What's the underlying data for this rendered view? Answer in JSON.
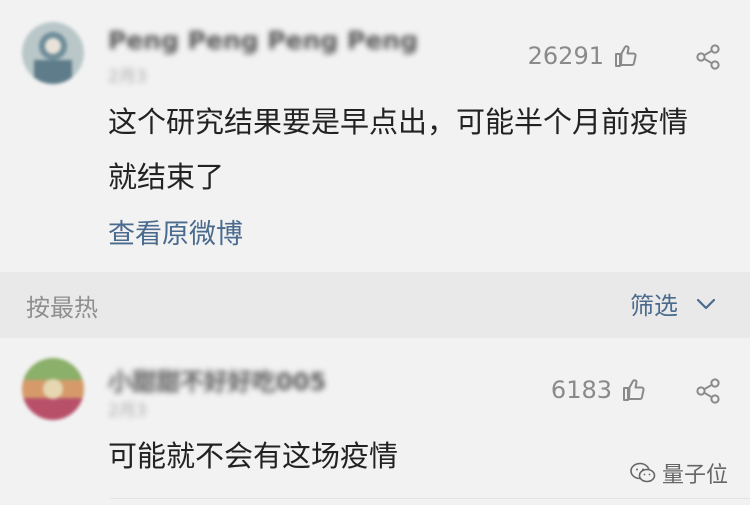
{
  "comments": [
    {
      "username": "Peng Peng Peng Peng",
      "meta": "2月3",
      "likes": "26291",
      "text_lines": [
        "这个研究结果要是早点出，可能半个月前疫情",
        "就结束了"
      ],
      "link": "查看原微博"
    },
    {
      "username": "小甜甜不好好吃005",
      "meta": "2月3",
      "likes": "6183",
      "text_lines": [
        "可能就不会有这场疫情"
      ]
    }
  ],
  "sort_bar": {
    "label": "按最热",
    "filter_label": "筛选"
  },
  "watermark": "量子位"
}
